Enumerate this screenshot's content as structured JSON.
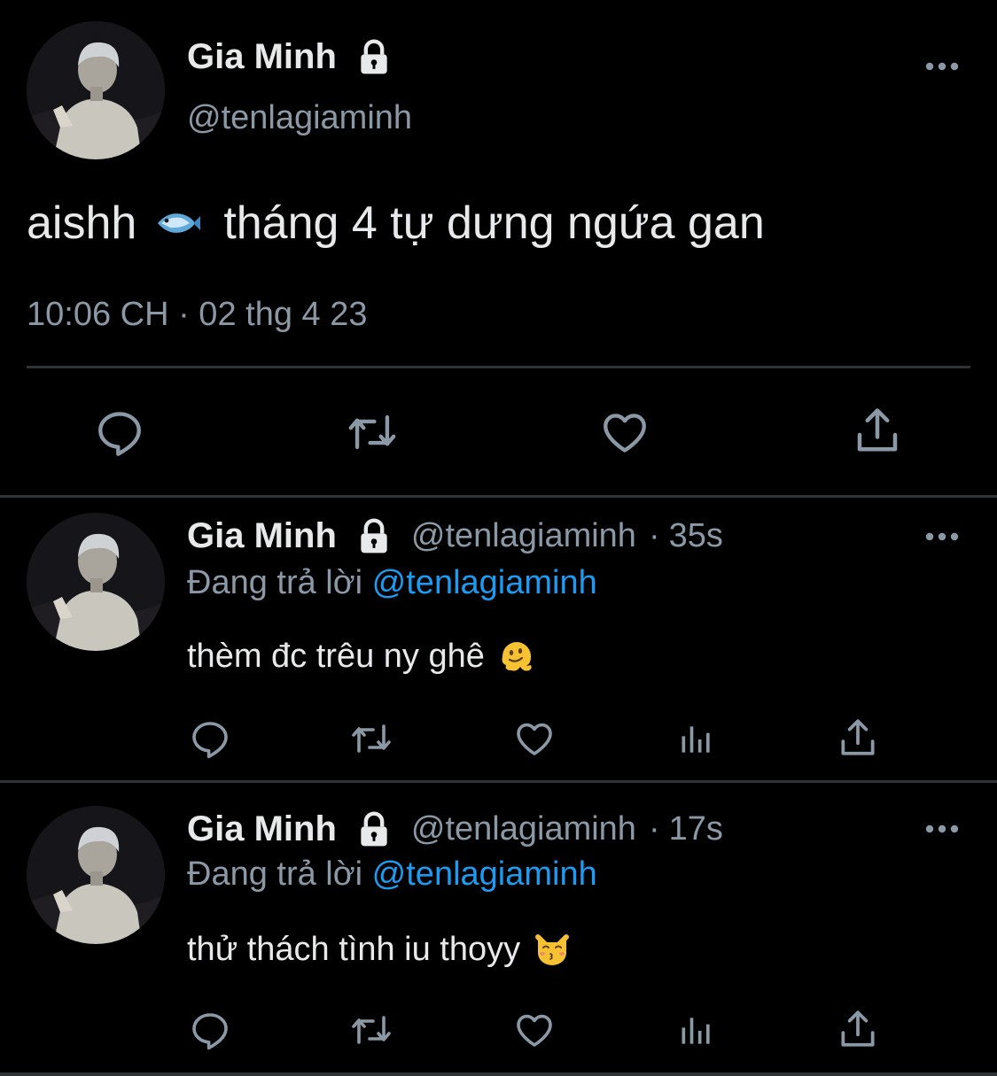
{
  "main_tweet": {
    "name": "Gia Minh",
    "handle": "@tenlagiaminh",
    "text_before": "aishh",
    "text_after": "tháng 4 tự dưng ngứa gan",
    "emoji": "fish-emoji",
    "timestamp": "10:06 CH · 02 thg 4 23",
    "icons": [
      "reply-icon",
      "retweet-icon",
      "like-icon",
      "share-icon"
    ]
  },
  "replies": [
    {
      "name": "Gia Minh",
      "handle": "@tenlagiaminh",
      "time_sep": "·",
      "time": "35s",
      "replying_label": "Đang trả lời",
      "replying_to": "@tenlagiaminh",
      "text": "thèm đc trêu ny ghê",
      "emoji": "melting-face-emoji"
    },
    {
      "name": "Gia Minh",
      "handle": "@tenlagiaminh",
      "time_sep": "·",
      "time": "17s",
      "replying_label": "Đang trả lời",
      "replying_to": "@tenlagiaminh",
      "text": "thử thách tình iu thoyy",
      "emoji": "kissing-cat-emoji"
    }
  ],
  "colors": {
    "background": "#000000",
    "text": "#e7e9ea",
    "secondary": "#8b98a5",
    "link": "#1d9bf0",
    "divider": "#2f3336"
  }
}
